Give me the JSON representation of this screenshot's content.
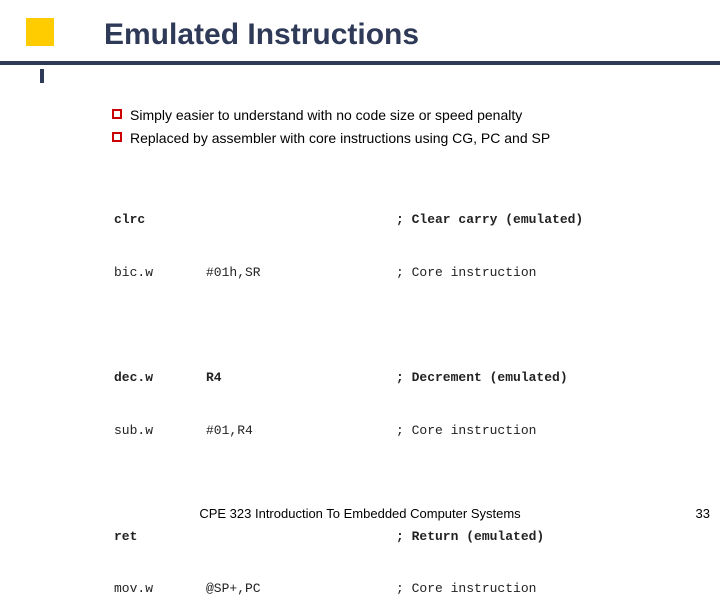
{
  "title": "Emulated Instructions",
  "bullets": [
    "Simply easier to understand with no code size or speed penalty",
    "Replaced by assembler with core instructions using CG, PC and SP"
  ],
  "code": {
    "groups": [
      {
        "emu": {
          "instr": "clrc",
          "args": "",
          "comment": "; Clear carry (emulated)"
        },
        "core": {
          "instr": "bic.w",
          "args": "#01h,SR",
          "comment": "; Core instruction"
        }
      },
      {
        "emu": {
          "instr": "dec.w",
          "args": "R4",
          "comment": "; Decrement (emulated)"
        },
        "core": {
          "instr": "sub.w",
          "args": "#01,R4",
          "comment": "; Core instruction"
        }
      },
      {
        "emu": {
          "instr": "ret",
          "args": "",
          "comment": "; Return (emulated)"
        },
        "core": {
          "instr": "mov.w",
          "args": "@SP+,PC",
          "comment": "; Core instruction"
        }
      }
    ]
  },
  "footer": {
    "course": "CPE 323 Introduction To Embedded Computer Systems",
    "page": "33"
  }
}
